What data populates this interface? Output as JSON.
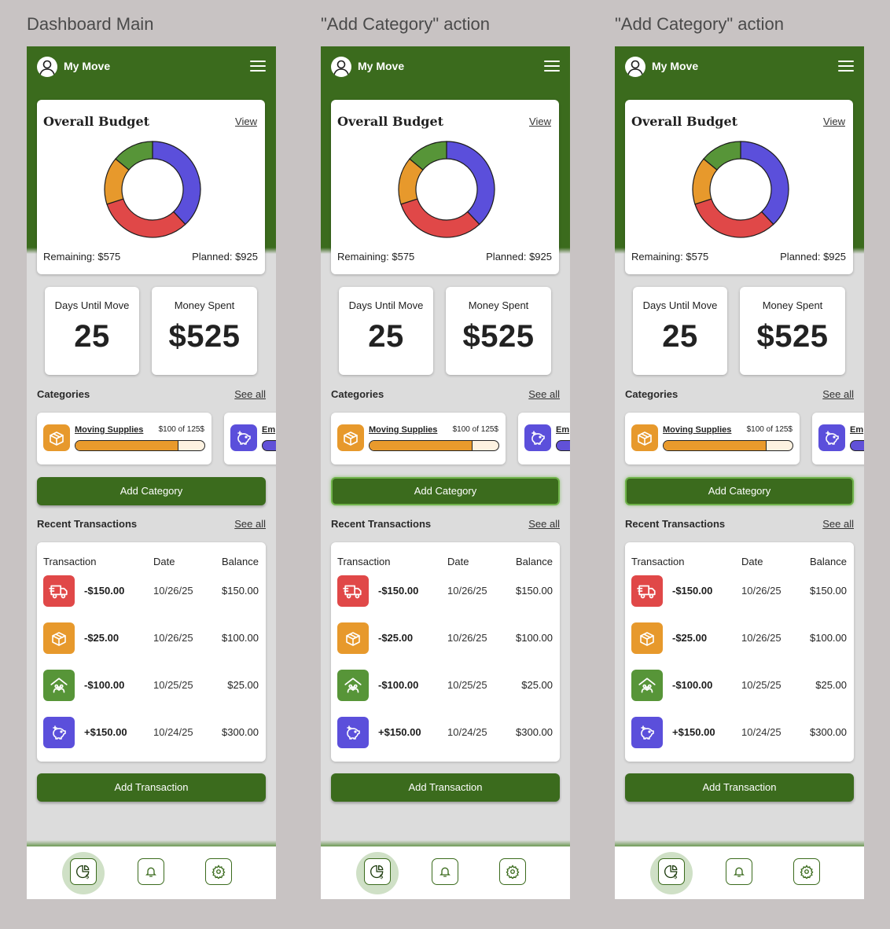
{
  "frames": [
    {
      "title": "Dashboard Main",
      "add_category_hover": false
    },
    {
      "title": "\"Add Category\" action",
      "add_category_hover": true
    },
    {
      "title": "\"Add Category\" action",
      "add_category_hover": true
    }
  ],
  "app": {
    "title": "My Move",
    "avatar_icon": "user-avatar-icon",
    "menu_icon": "hamburger-menu-icon"
  },
  "budget": {
    "title": "Overall Budget",
    "view_label": "View",
    "remaining": "Remaining: $575",
    "planned": "Planned: $925",
    "segments": [
      {
        "color": "#5b4fdb",
        "fraction": 0.38
      },
      {
        "color": "#e04848",
        "fraction": 0.32
      },
      {
        "color": "#e7992c",
        "fraction": 0.16
      },
      {
        "color": "#579538",
        "fraction": 0.14
      }
    ]
  },
  "stats": {
    "days_label": "Days Until Move",
    "days_value": "25",
    "spent_label": "Money Spent",
    "spent_value": "$525"
  },
  "categories": {
    "label": "Categories",
    "see_all": "See all",
    "items": [
      {
        "name": "Moving Supplies",
        "amount": "$100 of 125$",
        "progress": 0.8,
        "color": "#e7992c",
        "icon": "box-icon"
      },
      {
        "name": "Em",
        "color": "#5b4fdb",
        "icon": "piggy-bank-icon"
      }
    ]
  },
  "add_category_label": "Add Category",
  "transactions": {
    "label": "Recent Transactions",
    "see_all": "See all",
    "headers": {
      "transaction": "Transaction",
      "date": "Date",
      "balance": "Balance"
    },
    "rows": [
      {
        "amount": "-$150.00",
        "date": "10/26/25",
        "balance": "$150.00",
        "color": "#e04848",
        "icon": "moving-truck-icon"
      },
      {
        "amount": "-$25.00",
        "date": "10/26/25",
        "balance": "$100.00",
        "color": "#e7992c",
        "icon": "box-icon"
      },
      {
        "amount": "-$100.00",
        "date": "10/25/25",
        "balance": "$25.00",
        "color": "#579538",
        "icon": "home-family-icon"
      },
      {
        "amount": "+$150.00",
        "date": "10/24/25",
        "balance": "$300.00",
        "color": "#5b4fdb",
        "icon": "piggy-bank-icon"
      }
    ]
  },
  "add_transaction_label": "Add Transaction",
  "nav": [
    {
      "icon": "budget-chart-icon",
      "active": true
    },
    {
      "icon": "bell-icon",
      "active": false
    },
    {
      "icon": "gear-icon",
      "active": false
    }
  ]
}
